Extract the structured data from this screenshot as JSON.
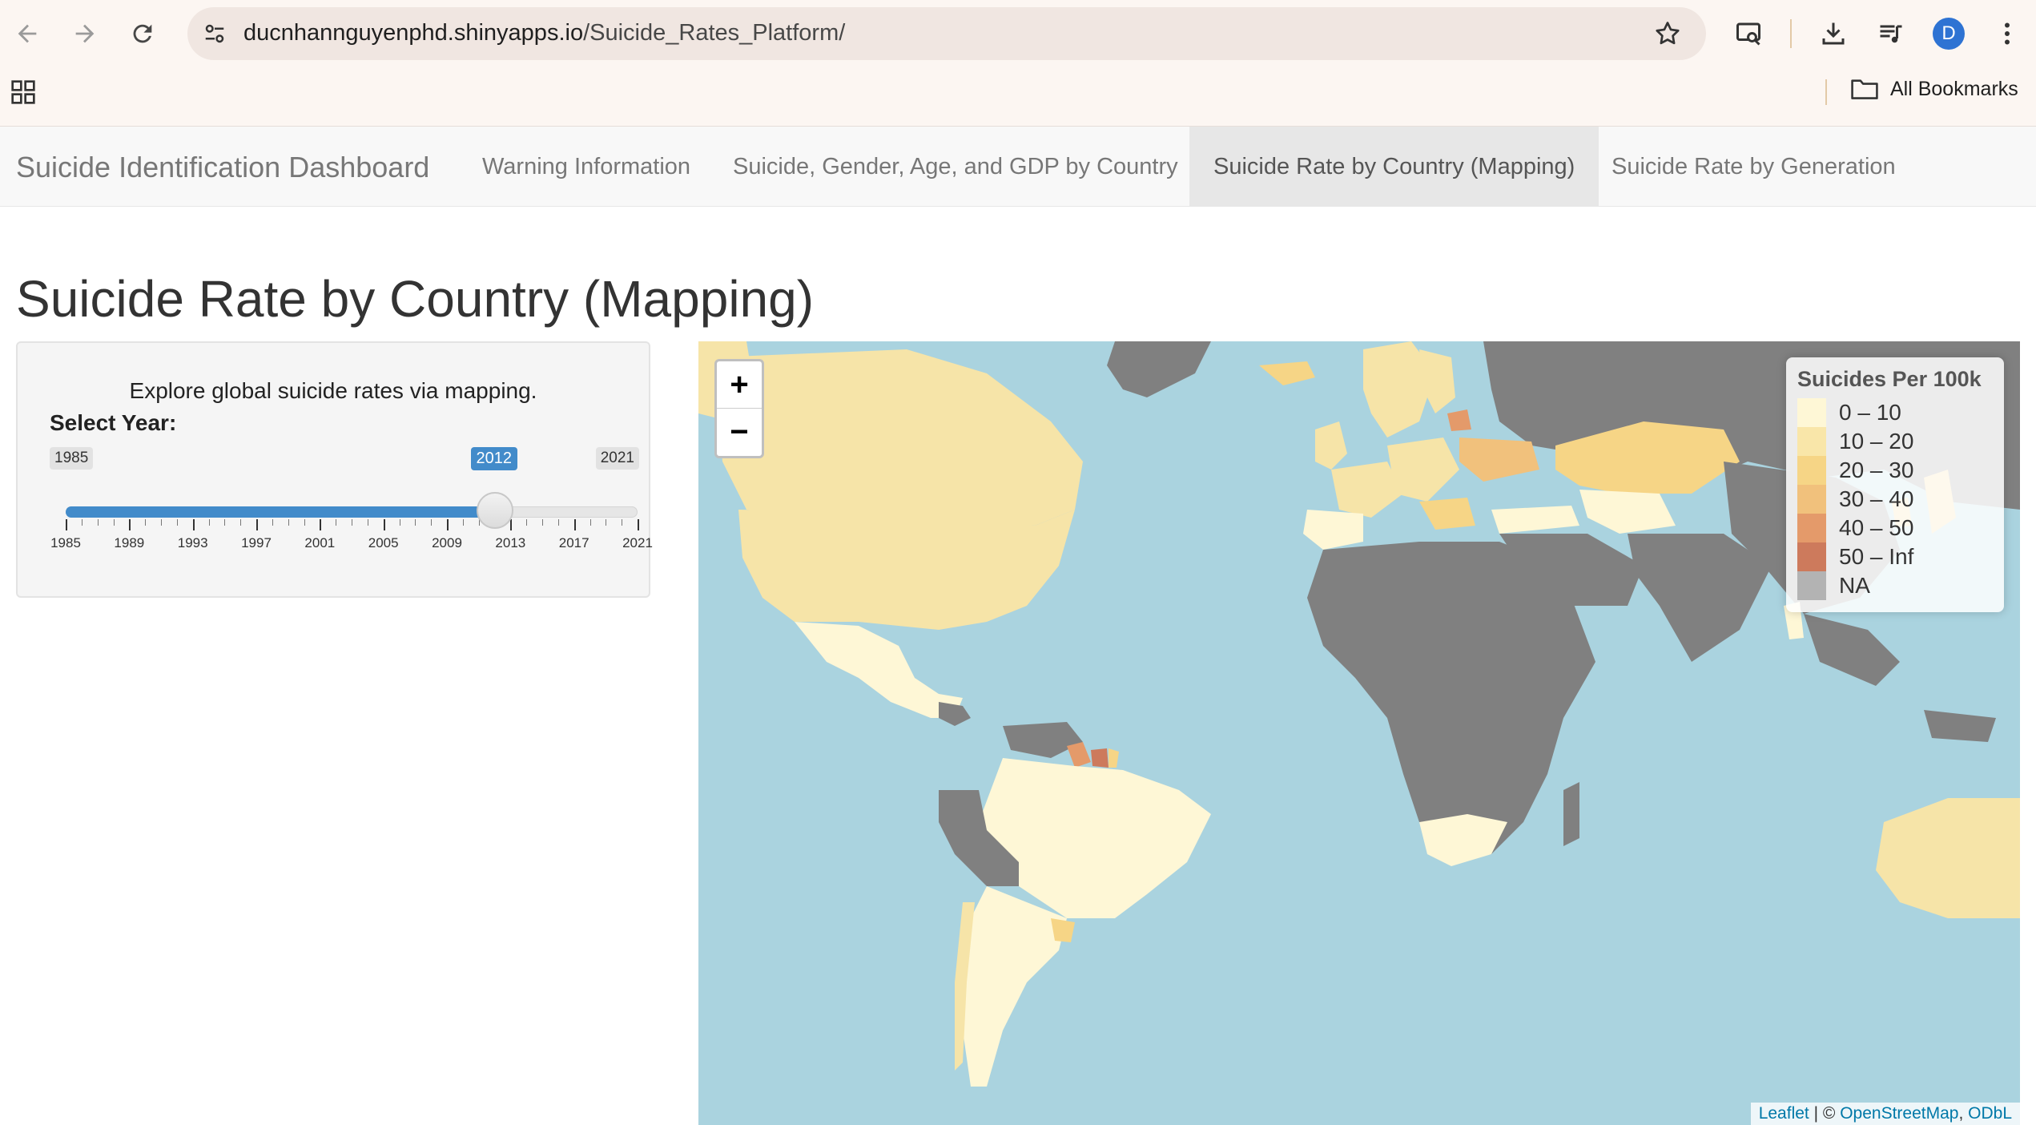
{
  "browser": {
    "url_host": "ducnhannguyenphd.shinyapps.io",
    "url_path": "/Suicide_Rates_Platform/",
    "avatar_initial": "D",
    "bookmarks_label": "All Bookmarks"
  },
  "navbar": {
    "brand": "Suicide Identification Dashboard",
    "tabs": [
      {
        "label": "Warning Information"
      },
      {
        "label": "Suicide, Gender, Age, and GDP by Country"
      },
      {
        "label": "Suicide Rate by Country (Mapping)"
      },
      {
        "label": "Suicide Rate by Generation"
      }
    ],
    "active_tab": "Suicide Rate by Country (Mapping)"
  },
  "page": {
    "title": "Suicide Rate by Country (Mapping)"
  },
  "sidebar": {
    "intro": "Explore global suicide rates via mapping.",
    "select_label": "Select Year:",
    "slider": {
      "min": 1985,
      "max": 2021,
      "value": 2012,
      "min_label": "1985",
      "max_label": "2021",
      "value_label": "2012",
      "tick_labels": [
        "1985",
        "1989",
        "1993",
        "1997",
        "2001",
        "2005",
        "2009",
        "2013",
        "2017",
        "2021"
      ]
    }
  },
  "map": {
    "zoom_in": "+",
    "zoom_out": "−",
    "legend": {
      "title": "Suicides Per 100k",
      "items": [
        {
          "label": "0 – 10",
          "color": "#fef7d6"
        },
        {
          "label": "10 – 20",
          "color": "#f9e6a9"
        },
        {
          "label": "20 – 30",
          "color": "#f6d586"
        },
        {
          "label": "30 – 40",
          "color": "#f1c17c"
        },
        {
          "label": "40 – 50",
          "color": "#e49a6a"
        },
        {
          "label": "50 – Inf",
          "color": "#cd7a5c"
        },
        {
          "label": "NA",
          "color": "#b3b3b3"
        }
      ]
    },
    "attribution": {
      "leaflet": "Leaflet",
      "sep": " | © ",
      "osm": "OpenStreetMap",
      "comma": ", ",
      "odbl": "ODbL"
    },
    "colors": {
      "ocean": "#aad3df",
      "na_land": "#808080",
      "bin_0_10": "#fef7d6",
      "bin_10_20": "#f9e6a9",
      "bin_20_30": "#f6d586",
      "bin_30_40": "#f1c17c",
      "bin_40_50": "#e49a6a",
      "bin_50_inf": "#cd7a5c"
    }
  }
}
